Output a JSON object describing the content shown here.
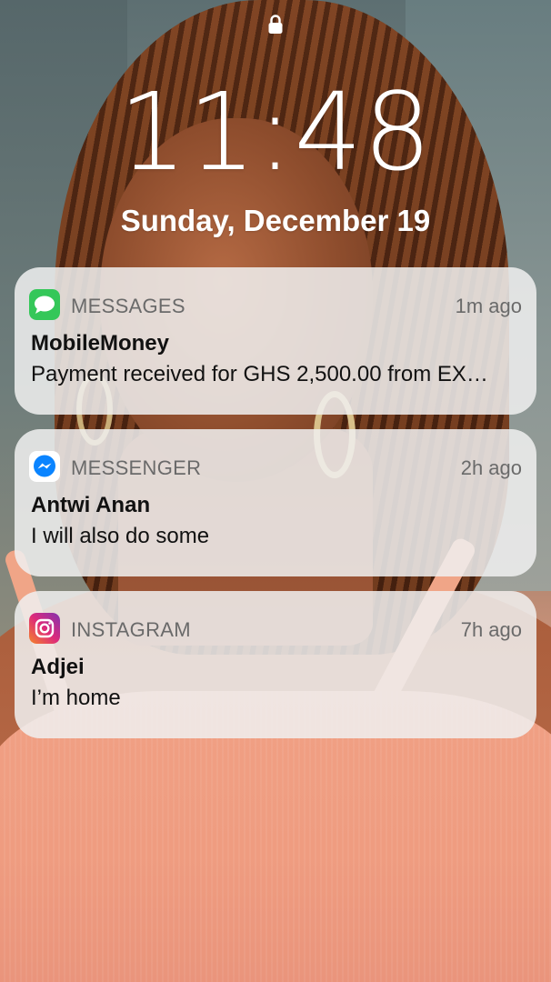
{
  "lock_screen": {
    "time": "11:48",
    "date": "Sunday, December 19"
  },
  "notifications": [
    {
      "app": "MESSAGES",
      "icon": "messages-icon",
      "time_ago": "1m ago",
      "sender": "MobileMoney",
      "message": "Payment received for GHS 2,500.00 from EX…"
    },
    {
      "app": "MESSENGER",
      "icon": "messenger-icon",
      "time_ago": "2h ago",
      "sender": "Antwi Anan",
      "message": "I will also do some"
    },
    {
      "app": "INSTAGRAM",
      "icon": "instagram-icon",
      "time_ago": "7h ago",
      "sender": "Adjei",
      "message": "I’m home"
    }
  ],
  "colors": {
    "messages_green": "#34c759",
    "messenger_blue": "#0a84ff",
    "instagram_gradient": "#f58529-#dd2a7b-#8134af"
  }
}
